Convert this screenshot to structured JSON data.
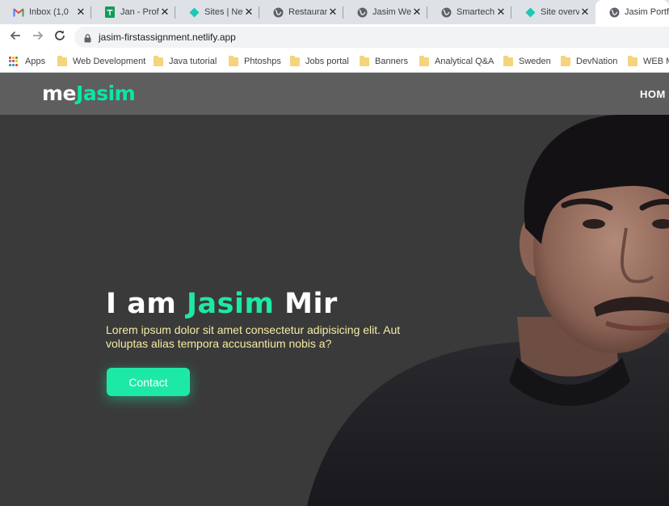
{
  "browser": {
    "tabs": [
      {
        "label": "Inbox (1,0",
        "icon": "gmail-icon"
      },
      {
        "label": "Jan - Profi",
        "icon": "sheets-icon"
      },
      {
        "label": "Sites | Netl",
        "icon": "netlify-icon"
      },
      {
        "label": "Restaurant",
        "icon": "globe-icon"
      },
      {
        "label": "Jasim Wea",
        "icon": "globe-icon"
      },
      {
        "label": "Smartech",
        "icon": "globe-icon"
      },
      {
        "label": "Site overvi",
        "icon": "netlify-icon"
      },
      {
        "label": "Jasim Portf",
        "icon": "globe-icon",
        "active": true
      }
    ],
    "url": "jasim-firstassignment.netlify.app",
    "bookmarks": [
      "Apps",
      "Web Development",
      "Java tutorial",
      "Phtoshps",
      "Jobs portal",
      "Banners",
      "Analytical Q&A",
      "Sweden",
      "DevNation",
      "WEB M"
    ]
  },
  "site": {
    "logo_me": "me",
    "logo_name": "Jasim",
    "nav_home": "HOM",
    "hero": {
      "title_prefix": "I am ",
      "title_highlight": "Jasim",
      "title_suffix": " Mir",
      "subtitle": "Lorem ipsum dolor sit amet consectetur adipisicing elit. Aut voluptas alias tempora accusantium nobis a?",
      "button_label": "Contact"
    }
  },
  "colors": {
    "accent": "#1de9a6",
    "nav_bg": "#5e5e5e",
    "hero_bg": "#3a3a3a",
    "subtitle": "#f6eca2"
  }
}
